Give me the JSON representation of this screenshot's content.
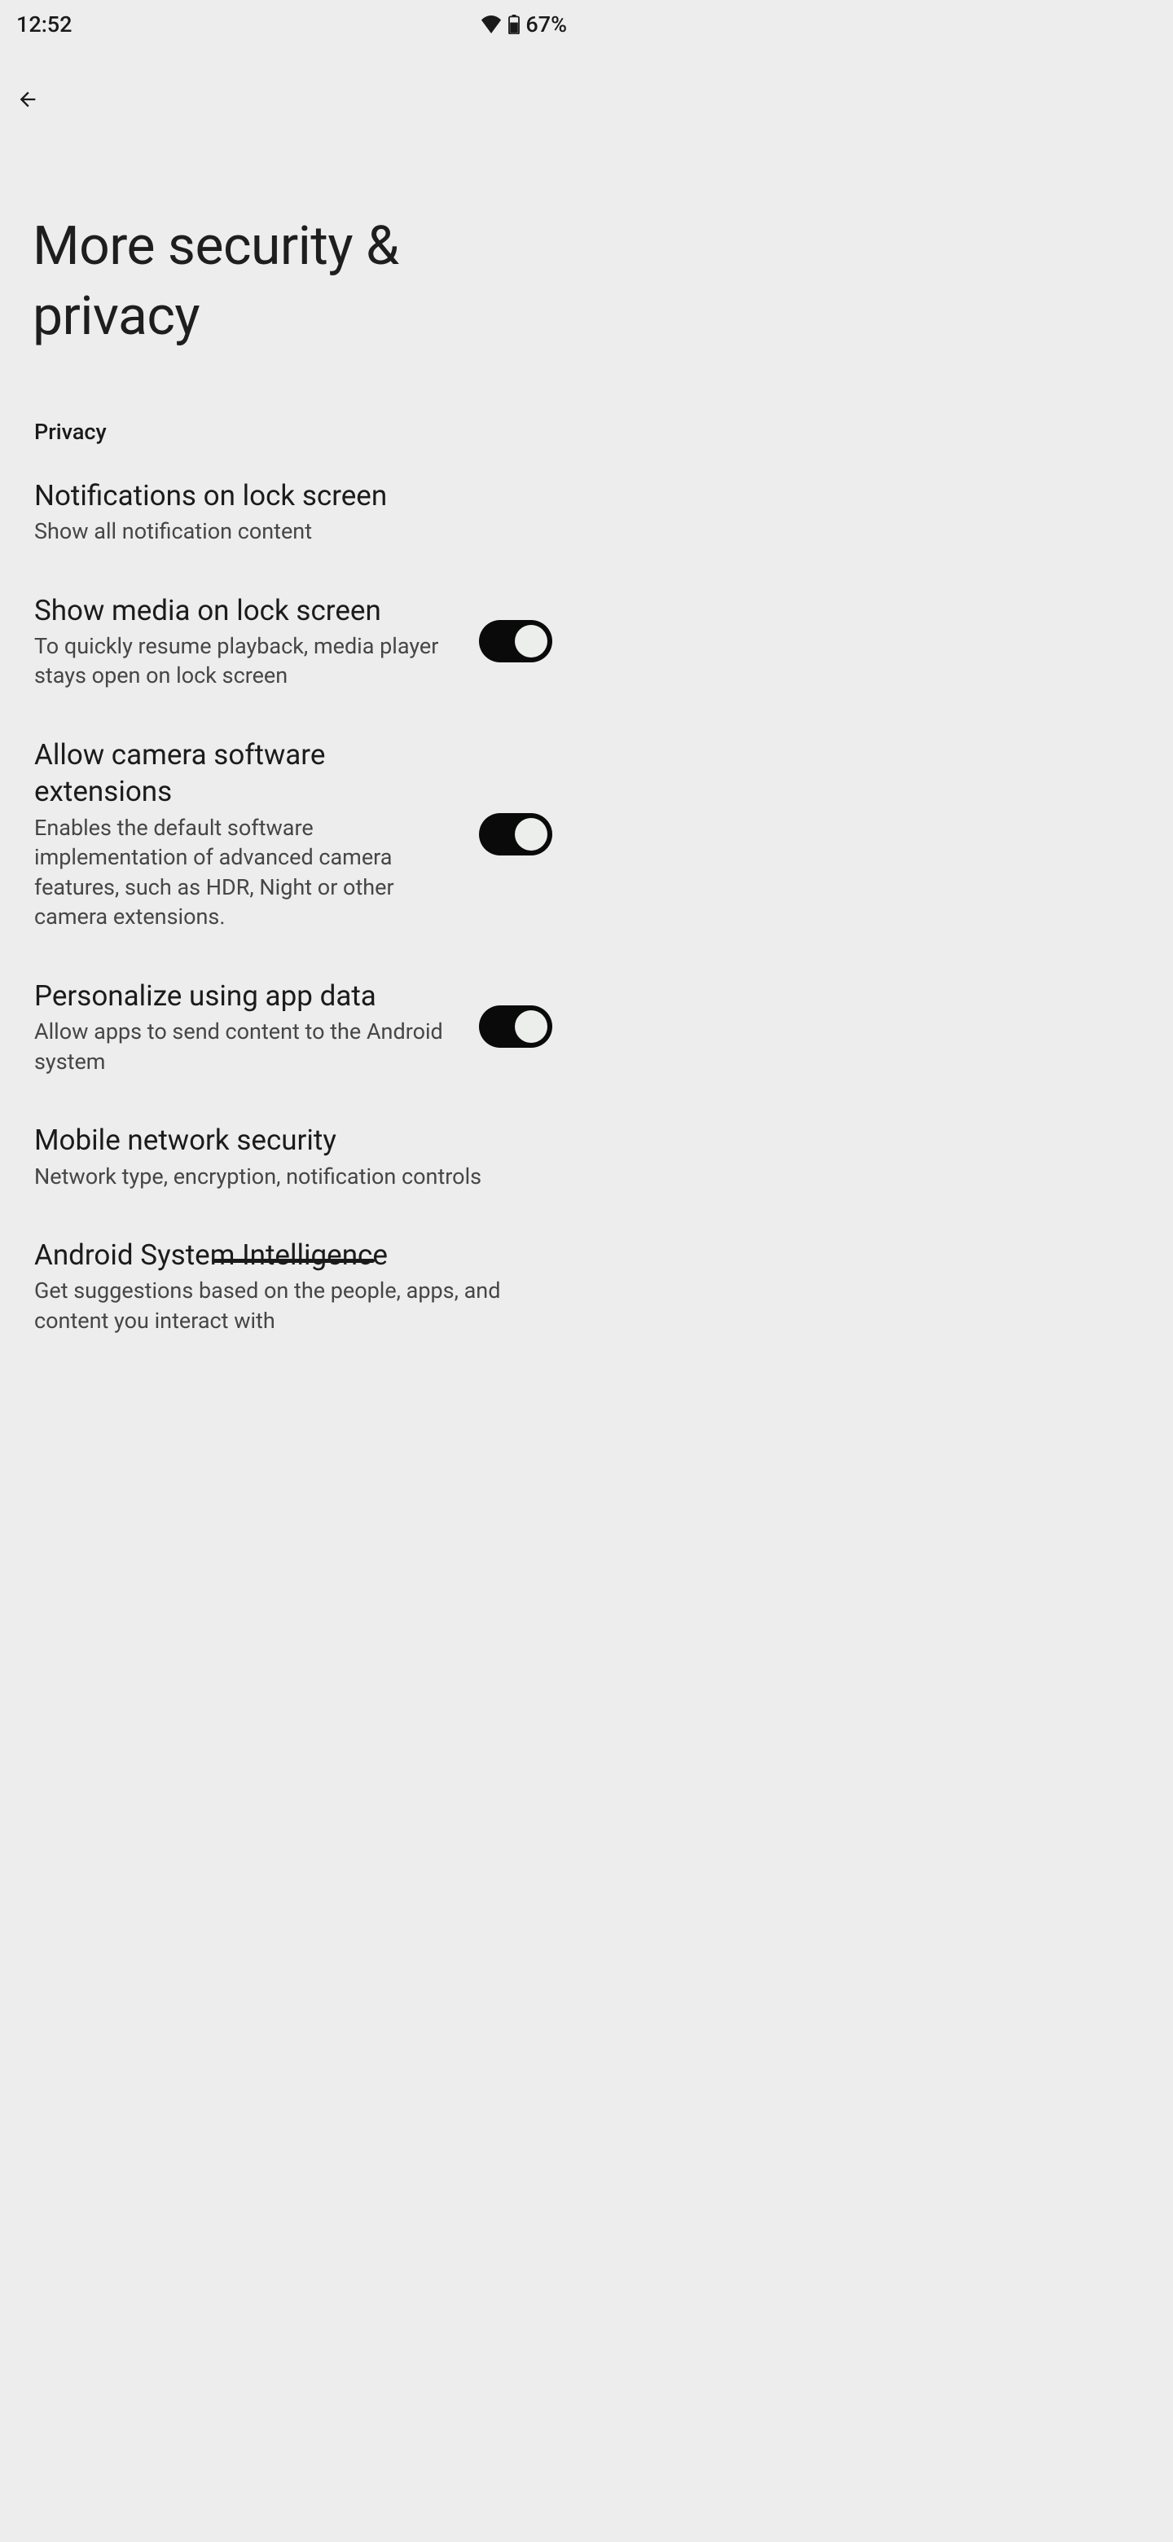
{
  "statusBar": {
    "time": "12:52",
    "battery": "67%"
  },
  "pageTitle": "More security & privacy",
  "section": {
    "header": "Privacy"
  },
  "settings": {
    "notifications": {
      "title": "Notifications on lock screen",
      "subtitle": "Show all notification content"
    },
    "showMedia": {
      "title": "Show media on lock screen",
      "subtitle": "To quickly resume playback, media player stays open on lock screen"
    },
    "cameraExtensions": {
      "title": "Allow camera software extensions",
      "subtitle": "Enables the default software implementation of advanced camera features, such as HDR, Night or other camera extensions."
    },
    "personalize": {
      "title": "Personalize using app data",
      "subtitle": "Allow apps to send content to the Android system"
    },
    "mobileNetwork": {
      "title": "Mobile network security",
      "subtitle": "Network type, encryption, notification controls"
    },
    "systemIntelligence": {
      "title": "Android System Intelligence",
      "subtitle": "Get suggestions based on the people, apps, and content you interact with"
    }
  }
}
